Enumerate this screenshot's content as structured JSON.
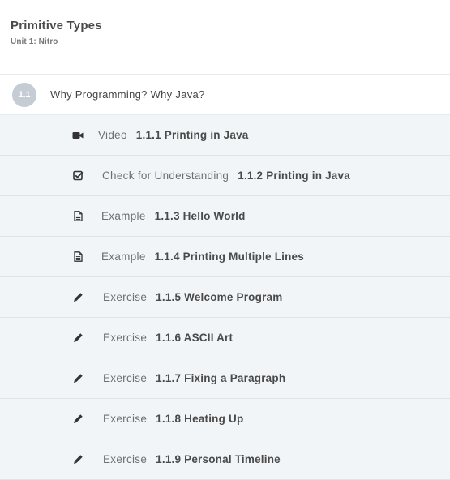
{
  "header": {
    "title": "Primitive Types",
    "subtitle": "Unit 1: Nitro"
  },
  "section": {
    "number": "1.1",
    "title": "Why Programming? Why Java?"
  },
  "items": [
    {
      "icon": "video-camera-icon",
      "type": "Video",
      "title": "1.1.1 Printing in Java"
    },
    {
      "icon": "checkbox-icon",
      "type": "Check for Understanding",
      "title": "1.1.2 Printing in Java"
    },
    {
      "icon": "document-icon",
      "type": "Example",
      "title": "1.1.3 Hello World"
    },
    {
      "icon": "document-icon",
      "type": "Example",
      "title": "1.1.4 Printing Multiple Lines"
    },
    {
      "icon": "pencil-icon",
      "type": "Exercise",
      "title": "1.1.5 Welcome Program"
    },
    {
      "icon": "pencil-icon",
      "type": "Exercise",
      "title": "1.1.6 ASCII Art"
    },
    {
      "icon": "pencil-icon",
      "type": "Exercise",
      "title": "1.1.7 Fixing a Paragraph"
    },
    {
      "icon": "pencil-icon",
      "type": "Exercise",
      "title": "1.1.8 Heating Up"
    },
    {
      "icon": "pencil-icon",
      "type": "Exercise",
      "title": "1.1.9 Personal Timeline"
    }
  ],
  "colors": {
    "item_background": "#f2f5f8",
    "badge_background": "#c5ccd3",
    "icon_color": "#333333"
  }
}
